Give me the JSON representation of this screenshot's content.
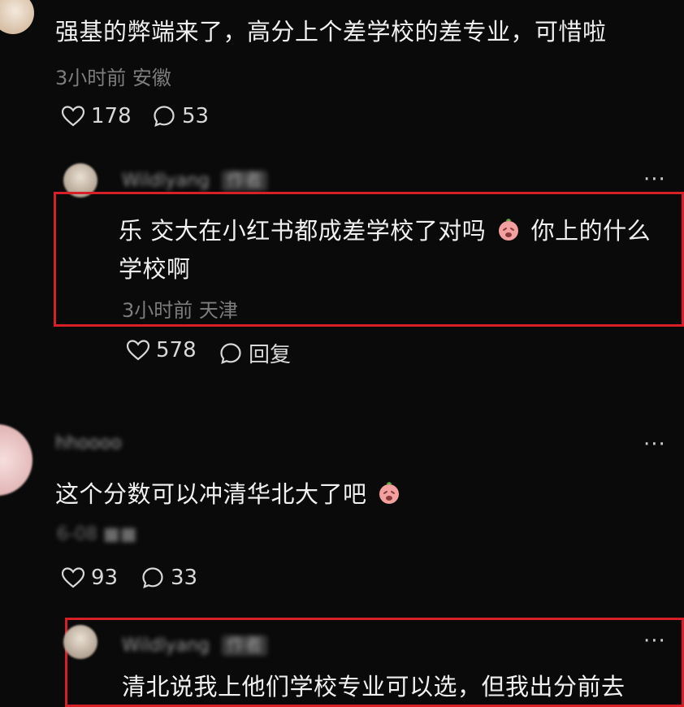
{
  "comments": [
    {
      "text": "强基的弊端来了，高分上个差学校的差专业，可惜啦",
      "time": "3小时前",
      "location": "安徽",
      "likes": "178",
      "replies_count": "53",
      "reply": {
        "username": "Wildlyang",
        "tag": "作者",
        "text_line1": "乐 交大在小红书都成差学校了对吗",
        "text_line1_end": "你上的什么",
        "text_line2": "学校啊",
        "time": "3小时前",
        "location": "天津",
        "likes": "578",
        "reply_label": "回复",
        "more": "···"
      }
    },
    {
      "username": "hhoooo",
      "text": "这个分数可以冲清华北大了吧",
      "meta_blurred": "6-08 ■■",
      "likes": "93",
      "replies_count": "33",
      "more": "···",
      "reply": {
        "username": "Wildlyang",
        "tag": "作者",
        "text_line1": "清北说我上他们学校专业可以选，但我出分前去",
        "more": "···"
      }
    }
  ],
  "icons": [
    "heart-icon",
    "comment-icon",
    "emoji-icon"
  ],
  "colors": {
    "background": "#0a0a0a",
    "highlight_box": "#d61f26",
    "meta": "#7d7d7d"
  }
}
